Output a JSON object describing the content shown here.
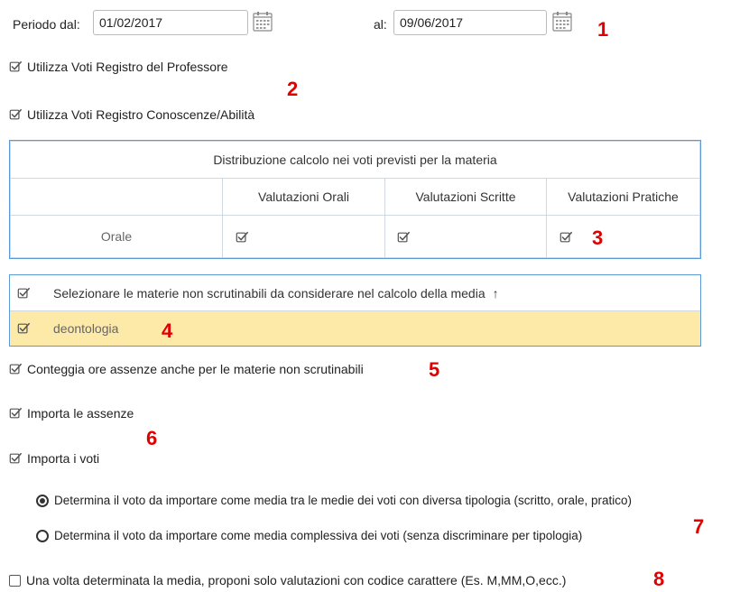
{
  "period": {
    "from_label": "Periodo dal:",
    "from_value": "01/02/2017",
    "to_label": "al:",
    "to_value": "09/06/2017"
  },
  "markers": [
    "1",
    "2",
    "3",
    "4",
    "5",
    "6",
    "7",
    "8"
  ],
  "options": {
    "use_prof_register": "Utilizza Voti Registro del Professore",
    "use_skills_register": "Utilizza Voti Registro Conoscenze/Abilità"
  },
  "distribution": {
    "title": "Distribuzione calcolo nei voti previsti per la materia",
    "columns": [
      "Valutazioni Orali",
      "Valutazioni Scritte",
      "Valutazioni Pratiche"
    ],
    "row_label": "Orale"
  },
  "non_scrutinable": {
    "header": "Selezionare le materie non scrutinabili da considerare nel calcolo della media",
    "sort_icon": "↑",
    "item": "deontologia"
  },
  "count_absences": "Conteggia ore assenze anche per le materie non scrutinabili",
  "import_absences": "Importa le assenze",
  "import_grades": "Importa i voti",
  "radio_options": [
    "Determina il voto da importare come media tra le medie dei voti con diversa tipologia (scritto, orale, pratico)",
    "Determina il voto da importare come media complessiva dei voti (senza discriminare per tipologia)"
  ],
  "char_code_option": "Una volta determinata la media, proponi solo valutazioni con codice carattere (Es. M,MM,O,ecc.)",
  "colors": {
    "accent_blue": "#5b9bd5",
    "highlight": "#fde9a8",
    "marker_red": "#e00000"
  }
}
